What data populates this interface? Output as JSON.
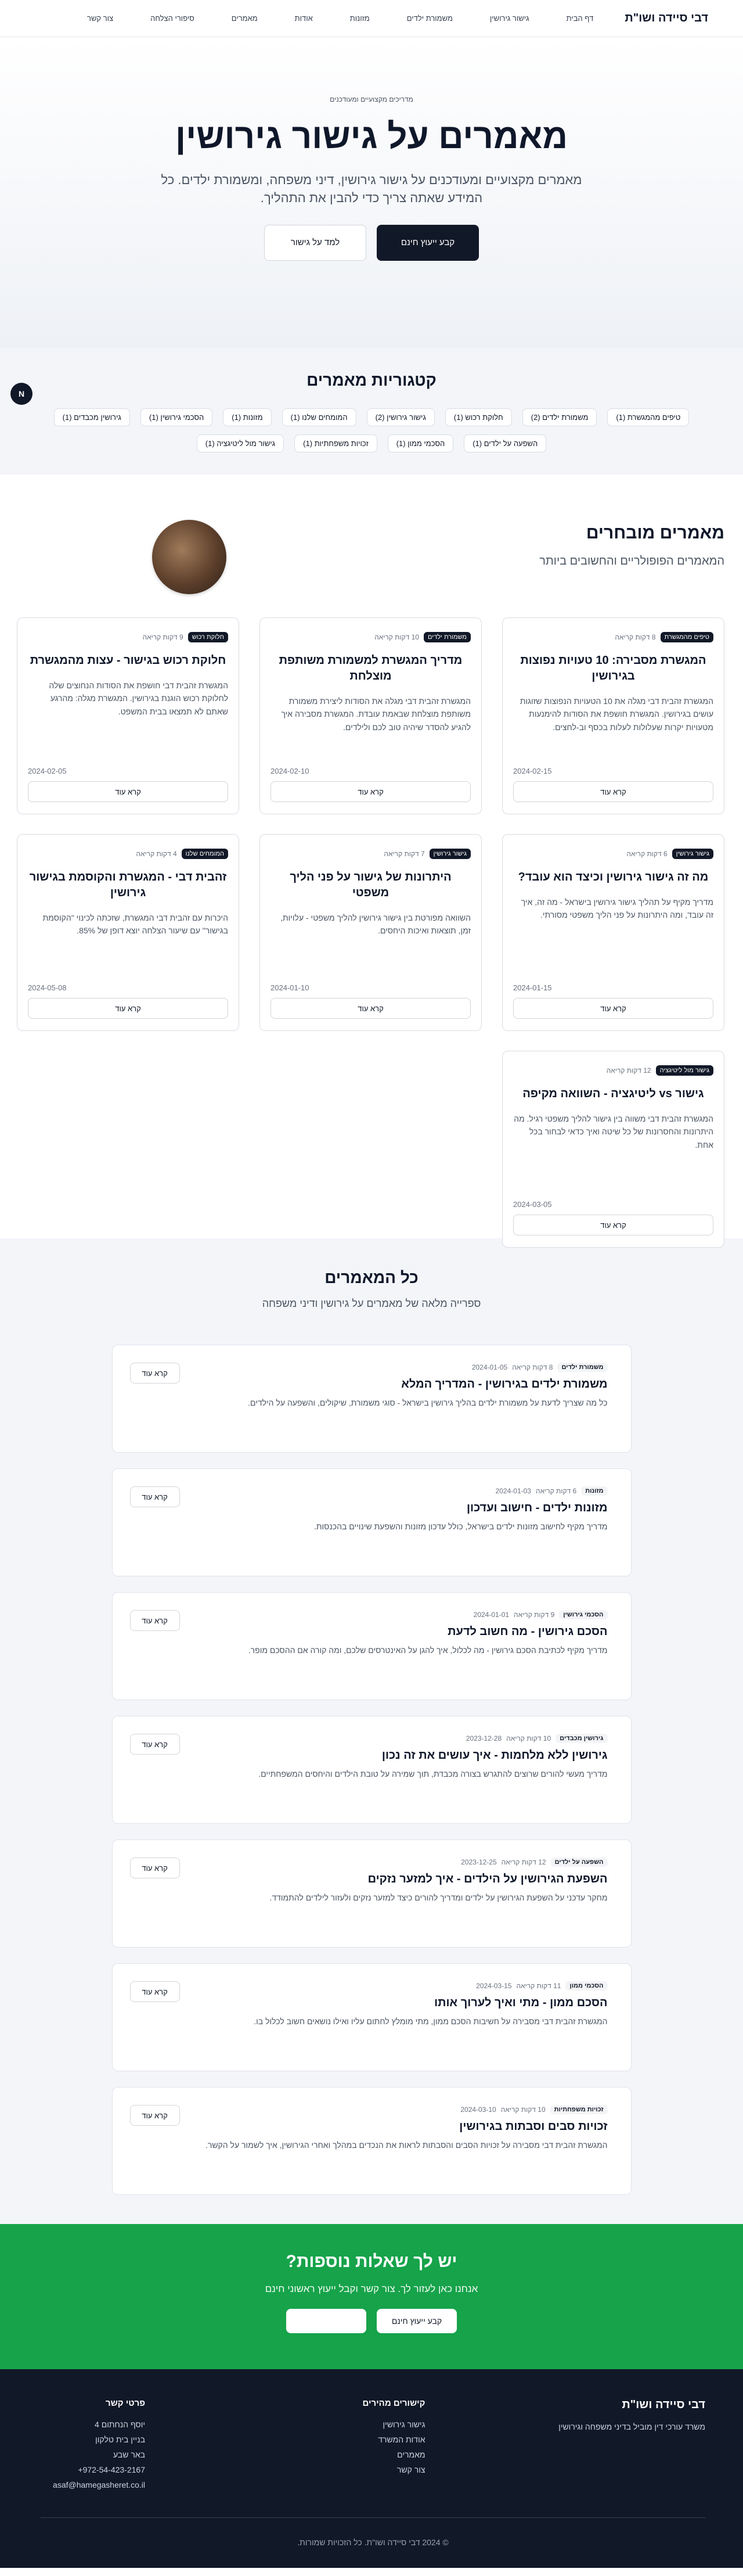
{
  "nav": {
    "logo": "דבי סיידה ושו\"ת",
    "links": [
      "דף הבית",
      "גישור גירושין",
      "משמורת ילדים",
      "מזונות",
      "אודות",
      "מאמרים",
      "סיפורי הצלחה",
      "צור קשר"
    ]
  },
  "hero": {
    "kicker": "מדריכים מקצועיים ומעודכנים",
    "title": "מאמרים על גישור גירושין",
    "subtitle": "מאמרים מקצועיים ומעודכנים על גישור גירושין, דיני משפחה, ומשמורת ילדים. כל המידע שאתה צריך כדי להבין את התהליך.",
    "primary_btn": "קבע ייעוץ חינם",
    "secondary_btn": "למד על גישור"
  },
  "categories": {
    "title": "קטגוריות מאמרים",
    "badge": "N",
    "items": [
      "טיפים מהמגשרת (1)",
      "משמורת ילדים (2)",
      "חלוקת רכוש (1)",
      "גישור גירושין (2)",
      "המומחים שלנו (1)",
      "מזונות (1)",
      "הסכמי גירושין (1)",
      "גירושין מכבדים (1)",
      "השפעה על ילדים (1)",
      "הסכמי ממון (1)",
      "זכויות משפחתיות (1)",
      "גישור מול ליטיגציה (1)"
    ]
  },
  "featured": {
    "title": "מאמרים מובחרים",
    "subtitle": "המאמרים הפופולריים והחשובים ביותר",
    "read_more": "קרא עוד",
    "cards": [
      {
        "tag": "טיפים מהמגשרת",
        "time": "8 דקות קריאה",
        "title": "המגשרת מסבירה: 10 טעויות נפוצות בגירושין",
        "text": "המגשרת זהבית דבי מגלה את 10 הטעויות הנפוצות שזוגות עושים בגירושין. המגשרת חושפת את הסודות להימנעות מטעויות יקרות שעלולות לעלות בכסף וב-לחצים.",
        "date": "2024-02-15"
      },
      {
        "tag": "משמורת ילדים",
        "time": "10 דקות קריאה",
        "title": "מדריך המגשרת למשמורת משותפת מוצלחת",
        "text": "המגשרת זהבית דבי מגלה את הסודות ליצירת משמורת משותפת מוצלחת שבאמת עובדת. המגשרת מסבירה איך להגיע להסדר שיהיה טוב לכם ולילדים.",
        "date": "2024-02-10"
      },
      {
        "tag": "חלוקת רכוש",
        "time": "9 דקות קריאה",
        "title": "חלוקת רכוש בגישור - עצות מהמגשרת",
        "text": "המגשרת זהבית דבי חושפת את הסודות הנחוצים שלה לחלוקת רכוש הוגנת בגירושין. המגשרת מגלה: מהרגע שאתם לא תמצאו בבית המשפט.",
        "date": "2024-02-05"
      },
      {
        "tag": "גישור גירושין",
        "time": "6 דקות קריאה",
        "title": "מה זה גישור גירושין וכיצד הוא עובד?",
        "text": "מדריך מקיף על תהליך גישור גירושין בישראל - מה זה, איך זה עובד, ומה היתרונות על פני הליך משפטי מסורתי.",
        "date": "2024-01-15"
      },
      {
        "tag": "גישור גירושין",
        "time": "7 דקות קריאה",
        "title": "היתרונות של גישור על פני הליך משפטי",
        "text": "השוואה מפורטת בין גישור גירושין להליך משפטי - עלויות, זמן, תוצאות ואיכות היחסים.",
        "date": "2024-01-10"
      },
      {
        "tag": "המומחים שלנו",
        "time": "4 דקות קריאה",
        "title": "זהבית דבי - המגשרת והקוסמת בגישור גירושין",
        "text": "היכרות עם זהבית דבי המגשרת, שזכתה לכינוי \"הקוסמת בגישור\" עם שיעור הצלחה יוצא דופן של 85%.",
        "date": "2024-05-08"
      },
      {
        "tag": "גישור מול ליטיגציה",
        "time": "12 דקות קריאה",
        "title": "גישור vs ליטיגציה - השוואה מקיפה",
        "text": "המגשרת זהבית דבי משווה בין גישור להליך משפטי רגיל. מה היתרונות והחסרונות של כל שיטה ואיך כדאי לבחור בכל אחת.",
        "date": "2024-03-05"
      }
    ]
  },
  "all_articles": {
    "title": "כל המאמרים",
    "subtitle": "ספרייה מלאה של מאמרים על גירושין ודיני משפחה",
    "read_more": "קרא עוד",
    "rows": [
      {
        "tag": "משמורת ילדים",
        "time": "8 דקות קריאה",
        "date": "2024-01-05",
        "title": "משמורת ילדים בגירושין - המדריך המלא",
        "text": "כל מה שצריך לדעת על משמורת ילדים בהליך גירושין בישראל - סוגי משמורת, שיקולים, והשפעה על הילדים."
      },
      {
        "tag": "מזונות",
        "time": "6 דקות קריאה",
        "date": "2024-01-03",
        "title": "מזונות ילדים - חישוב ועדכון",
        "text": "מדריך מקיף לחישוב מזונות ילדים בישראל, כולל עדכון מזונות והשפעת שינויים בהכנסות."
      },
      {
        "tag": "הסכמי גירושין",
        "time": "9 דקות קריאה",
        "date": "2024-01-01",
        "title": "הסכם גירושין - מה חשוב לדעת",
        "text": "מדריך מקיף לכתיבת הסכם גירושין - מה לכלול, איך להגן על האינטרסים שלכם, ומה קורה אם ההסכם מופר."
      },
      {
        "tag": "גירושין מכבדים",
        "time": "10 דקות קריאה",
        "date": "2023-12-28",
        "title": "גירושין ללא מלחמות - איך עושים את זה נכון",
        "text": "מדריך מעשי להורים שרוצים להתגרש בצורה מכבדת, תוך שמירה על טובת הילדים והיחסים המשפחתיים."
      },
      {
        "tag": "השפעה על ילדים",
        "time": "12 דקות קריאה",
        "date": "2023-12-25",
        "title": "השפעת הגירושין על הילדים - איך למזער נזקים",
        "text": "מחקר עדכני על השפעת הגירושין על ילדים ומדריך להורים כיצד למזער נזקים ולעזור לילדים להתמודד."
      },
      {
        "tag": "הסכמי ממון",
        "time": "11 דקות קריאה",
        "date": "2024-03-15",
        "title": "הסכם ממון - מתי ואיך לערוך אותו",
        "text": "המגשרת זהבית דבי מסבירה על חשיבות הסכם ממון, מתי מומלץ לחתום עליו ואילו נושאים חשוב לכלול בו."
      },
      {
        "tag": "זכויות משפחתיות",
        "time": "10 דקות קריאה",
        "date": "2024-03-10",
        "title": "זכויות סבים וסבתות בגירושין",
        "text": "המגשרת זהבית דבי מסבירה על זכויות הסבים והסבתות לראות את הנכדים במהלך ואחרי הגירושין, איך לשמור על הקשר."
      }
    ]
  },
  "cta": {
    "title": "יש לך שאלות נוספות?",
    "subtitle": "אנחנו כאן לעזור לך. צור קשר וקבל ייעוץ ראשוני חינם",
    "primary_btn": "קבע ייעוץ חינם",
    "secondary_btn": ""
  },
  "footer": {
    "brand": "דבי סיידה ושו\"ת",
    "brand_desc": "משרד עורכי דין מוביל בדיני משפחה וגירושין",
    "links_title": "קישורים מהירים",
    "links": [
      "גישור גירושין",
      "אודות המשרד",
      "מאמרים",
      "צור קשר"
    ],
    "contact_title": "פרטי קשר",
    "contact": [
      "יוסף הנחתום 4",
      "בניין בית טלקון",
      "באר שבע",
      "+972-54-423-2167",
      "asaf@hamegasheret.co.il"
    ],
    "copyright": "© 2024 דבי סיידה ושו\"ת. כל הזכויות שמורות."
  },
  "colors": {
    "accent": "#16a34a",
    "dark": "#111827",
    "footer_bg": "#111827"
  }
}
